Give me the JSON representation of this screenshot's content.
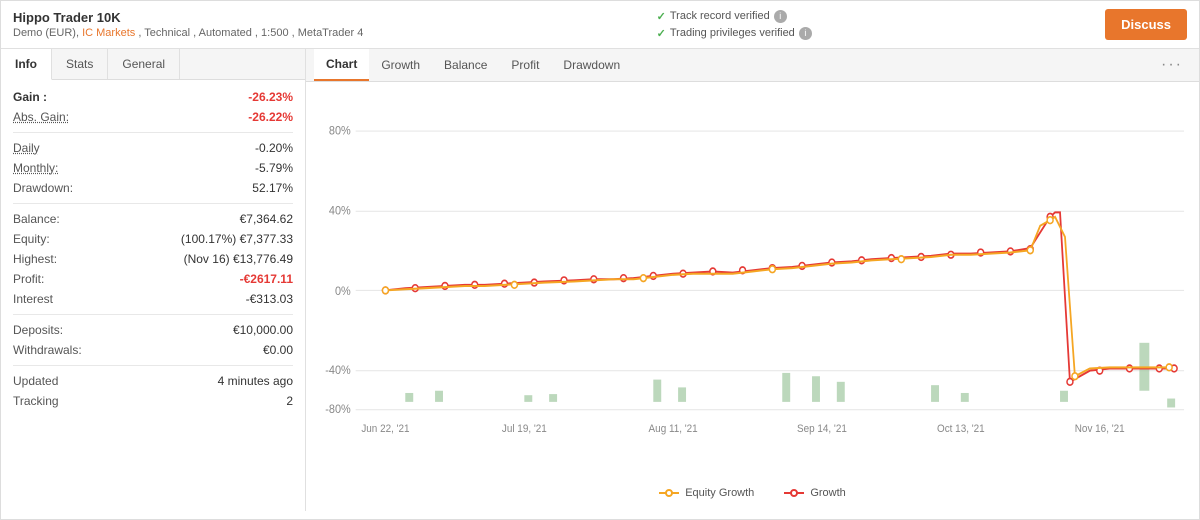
{
  "header": {
    "title": "Hippo Trader 10K",
    "subtitle_prefix": "Demo (EUR),",
    "broker": "IC Markets",
    "subtitle_suffix": ", Technical , Automated , 1:500 , MetaTrader 4",
    "verified1": "Track record verified",
    "verified2": "Trading privileges verified",
    "discuss_label": "Discuss"
  },
  "left_tabs": [
    {
      "label": "Info",
      "active": true
    },
    {
      "label": "Stats",
      "active": false
    },
    {
      "label": "General",
      "active": false
    }
  ],
  "stats": {
    "gain_label": "Gain :",
    "gain_value": "-26.23%",
    "abs_gain_label": "Abs. Gain:",
    "abs_gain_value": "-26.22%",
    "daily_label": "Daily",
    "daily_value": "-0.20%",
    "monthly_label": "Monthly:",
    "monthly_value": "-5.79%",
    "drawdown_label": "Drawdown:",
    "drawdown_value": "52.17%",
    "balance_label": "Balance:",
    "balance_value": "€7,364.62",
    "equity_label": "Equity:",
    "equity_value": "(100.17%) €7,377.33",
    "highest_label": "Highest:",
    "highest_value": "(Nov 16) €13,776.49",
    "profit_label": "Profit:",
    "profit_value": "-€2617.11",
    "interest_label": "Interest",
    "interest_value": "-€313.03",
    "deposits_label": "Deposits:",
    "deposits_value": "€10,000.00",
    "withdrawals_label": "Withdrawals:",
    "withdrawals_value": "€0.00",
    "updated_label": "Updated",
    "updated_value": "4 minutes ago",
    "tracking_label": "Tracking",
    "tracking_value": "2"
  },
  "chart_tabs": [
    {
      "label": "Chart",
      "active": true
    },
    {
      "label": "Growth",
      "active": false
    },
    {
      "label": "Balance",
      "active": false
    },
    {
      "label": "Profit",
      "active": false
    },
    {
      "label": "Drawdown",
      "active": false
    }
  ],
  "chart": {
    "x_labels": [
      "Jun 22, '21",
      "Jul 19, '21",
      "Aug 11, '21",
      "Sep 14, '21",
      "Oct 13, '21",
      "Nov 16, '21"
    ],
    "y_labels": [
      "80%",
      "40%",
      "0%",
      "-40%",
      "-80%"
    ],
    "legend_equity": "Equity Growth",
    "legend_growth": "Growth"
  }
}
